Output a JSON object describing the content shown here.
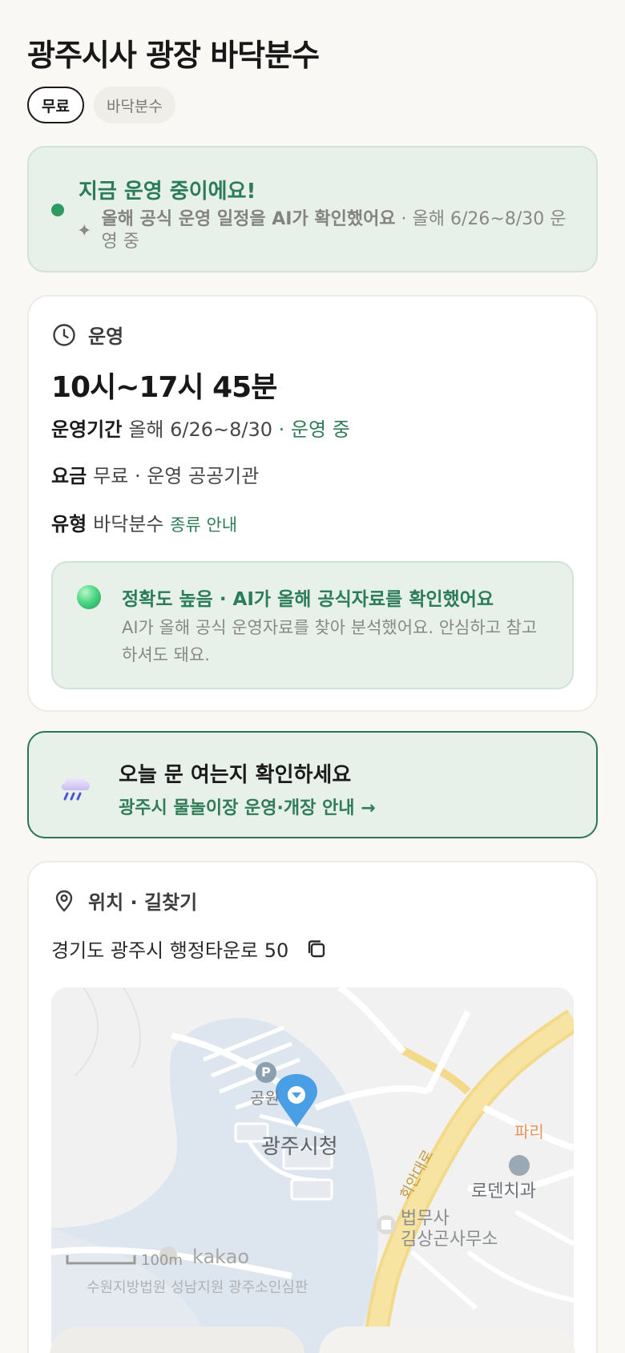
{
  "header": {
    "title": "광주시사 광장 바닥분수",
    "tags": [
      "무료",
      "바닥분수"
    ]
  },
  "status": {
    "title": "지금 운영 중이에요!",
    "ai_note": "올해 공식 운영 일정을 AI가 확인했어요",
    "period_note": " · 올해 6/26~8/30 운영 중"
  },
  "hours_card": {
    "section_label": "운영",
    "hours": "10시~17시 45분",
    "period_label": "운영기간",
    "period_value": "올해 6/26~8/30",
    "period_status": " · 운영 중",
    "fee_label": "요금",
    "fee_value": "무료 · 운영 공공기관",
    "type_label": "유형",
    "type_value": "바닥분수",
    "type_link": "종류 안내",
    "accuracy_title": "정확도 높음 · AI가 올해 공식자료를 확인했어요",
    "accuracy_desc": "AI가 올해 공식 운영자료를 찾아 분석했어요. 안심하고 참고하셔도 돼요."
  },
  "notice": {
    "title": "오늘 문 여는지 확인하세요",
    "link": "광주시 물놀이장 운영·개장 안내 →",
    "icon": "rain-cloud-icon"
  },
  "location": {
    "section_label": "위치 · 길찾기",
    "address": "경기도 광주시 행정타운로 50",
    "map": {
      "city_hall": "광주시청",
      "park": "공원",
      "road": "회안대로",
      "dentist": "로덴치과",
      "law_office_1": "법무사",
      "law_office_2": "김상곤사무소",
      "edge_text": "파리",
      "scale": "100m",
      "brand": "kakao",
      "bottom_text": "수원지방법원 성남지원 광주소인심판",
      "parking": "P"
    }
  },
  "colors": {
    "accent_green": "#2f7c57",
    "status_bg": "#e8f0ea",
    "marker_blue": "#4a9ee6"
  }
}
